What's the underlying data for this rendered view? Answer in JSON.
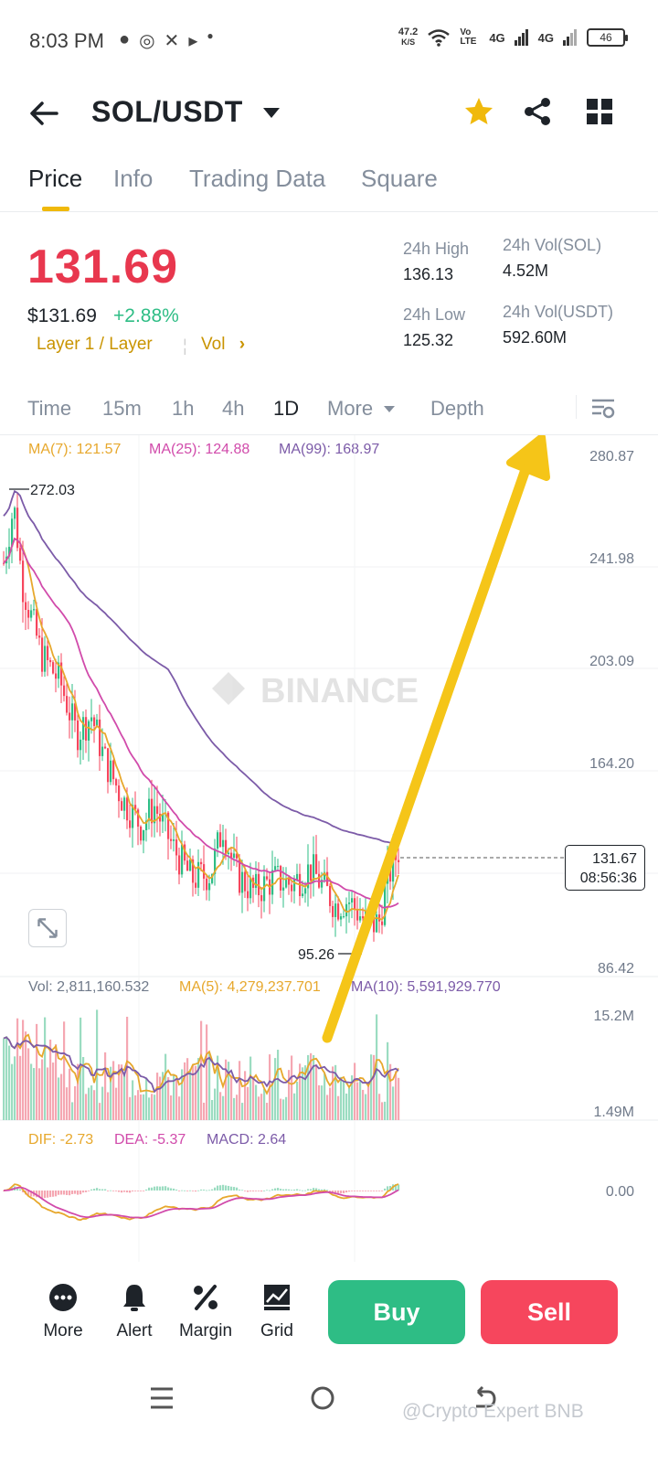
{
  "status_bar": {
    "time": "8:03 PM",
    "net_speed_value": "47.2",
    "net_speed_unit": "K/S",
    "volte": "Vo LTE",
    "signal1": "4G",
    "signal2": "4G",
    "battery": "46"
  },
  "header": {
    "pair": "SOL/USDT"
  },
  "tabs": [
    {
      "label": "Price"
    },
    {
      "label": "Info"
    },
    {
      "label": "Trading Data"
    },
    {
      "label": "Square"
    }
  ],
  "price": {
    "last": "131.69",
    "usd": "$131.69",
    "change": "+2.88%",
    "tags": "Layer 1 / Layer",
    "vol_link": "Vol"
  },
  "stats": {
    "high_label": "24h High",
    "high_value": "136.13",
    "low_label": "24h Low",
    "low_value": "125.32",
    "vol_sol_label": "24h Vol(SOL)",
    "vol_sol_value": "4.52M",
    "vol_usdt_label": "24h Vol(USDT)",
    "vol_usdt_value": "592.60M"
  },
  "intervals": [
    {
      "label": "Time"
    },
    {
      "label": "15m"
    },
    {
      "label": "1h"
    },
    {
      "label": "4h"
    },
    {
      "label": "1D"
    },
    {
      "label": "More"
    },
    {
      "label": "Depth"
    }
  ],
  "ma_legend": {
    "ma7": "MA(7): 121.57",
    "ma25": "MA(25): 124.88",
    "ma99": "MA(99): 168.97"
  },
  "price_axis": [
    "280.87",
    "241.98",
    "203.09",
    "164.20",
    "86.42"
  ],
  "markers": {
    "high": "272.03",
    "low": "95.26"
  },
  "current_badge": {
    "price": "131.67",
    "countdown": "08:56:36"
  },
  "watermark": "BINANCE",
  "volume": {
    "vol": "Vol: 2,811,160.532",
    "ma5": "MA(5): 4,279,237.701",
    "ma10": "MA(10): 5,591,929.770",
    "axis_top": "15.2M",
    "axis_bottom": "1.49M"
  },
  "macd": {
    "dif": "DIF: -2.73",
    "dea": "DEA: -5.37",
    "macd": "MACD: 2.64",
    "axis_zero": "0.00"
  },
  "bottom_nav": [
    {
      "label": "More",
      "icon": "more-icon"
    },
    {
      "label": "Alert",
      "icon": "bell-icon"
    },
    {
      "label": "Margin",
      "icon": "percent-icon"
    },
    {
      "label": "Grid",
      "icon": "grid-bot-icon"
    }
  ],
  "actions": {
    "buy": "Buy",
    "sell": "Sell"
  },
  "footer_watermark": "@Crypto Expert BNB",
  "colors": {
    "up": "#2ebd85",
    "down": "#f6465d",
    "price_red": "#e8374e",
    "accent": "#f0b90b",
    "ma7": "#e7a82d",
    "ma25": "#d14bab",
    "ma99": "#7c5ba8",
    "arrow": "#f5c518"
  },
  "chart_data": {
    "type": "candlestick",
    "y_range": [
      86.42,
      280.87
    ],
    "high_marker": 272.03,
    "low_marker": 95.26,
    "last_price": 131.67,
    "ma_legend_values": {
      "ma7": 121.57,
      "ma25": 124.88,
      "ma99": 168.97
    }
  }
}
